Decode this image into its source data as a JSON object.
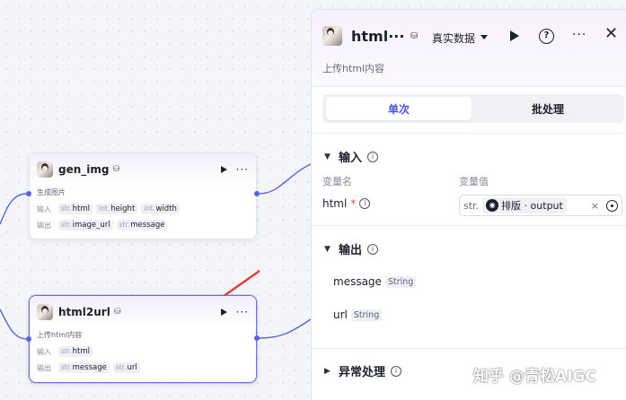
{
  "canvas": {
    "nodes": [
      {
        "title": "gen_img",
        "desc": "生成图片",
        "input_label": "输入",
        "inputs": [
          {
            "type": "str.",
            "name": "html"
          },
          {
            "type": "int.",
            "name": "height"
          },
          {
            "type": "int.",
            "name": "width"
          }
        ],
        "output_label": "输出",
        "outputs": [
          {
            "type": "str.",
            "name": "image_url"
          },
          {
            "type": "str.",
            "name": "message"
          }
        ]
      },
      {
        "title": "html2url",
        "desc": "上传html内容",
        "input_label": "输入",
        "inputs": [
          {
            "type": "str.",
            "name": "html"
          }
        ],
        "output_label": "输出",
        "outputs": [
          {
            "type": "str.",
            "name": "message"
          },
          {
            "type": "str.",
            "name": "url"
          }
        ]
      }
    ],
    "accent_color": "#5963d8",
    "arrow_color": "#e53935"
  },
  "panel": {
    "title": "html···",
    "data_mode": "真实数据",
    "subtitle": "上传html内容",
    "tabs": [
      "单次",
      "批处理"
    ],
    "active_tab": "单次",
    "input_section": {
      "title": "输入",
      "col_name": "变量名",
      "col_value": "变量值",
      "var_name": "html",
      "required_mark": "*",
      "value_type": "str.",
      "value_ref": "排版 · output"
    },
    "output_section": {
      "title": "输出",
      "items": [
        {
          "name": "message",
          "type": "String"
        },
        {
          "name": "url",
          "type": "String"
        }
      ]
    },
    "error_section": {
      "title": "异常处理"
    },
    "icons": [
      "avatar-icon",
      "database-icon",
      "chevron-down-icon",
      "play-icon",
      "help-icon",
      "more-icon",
      "close-icon",
      "info-icon",
      "chevron-right-icon",
      "target-icon",
      "clear-icon"
    ],
    "accent_color": "#4c55d6"
  },
  "watermark": {
    "site": "知乎",
    "author": "@青松AIGC"
  }
}
